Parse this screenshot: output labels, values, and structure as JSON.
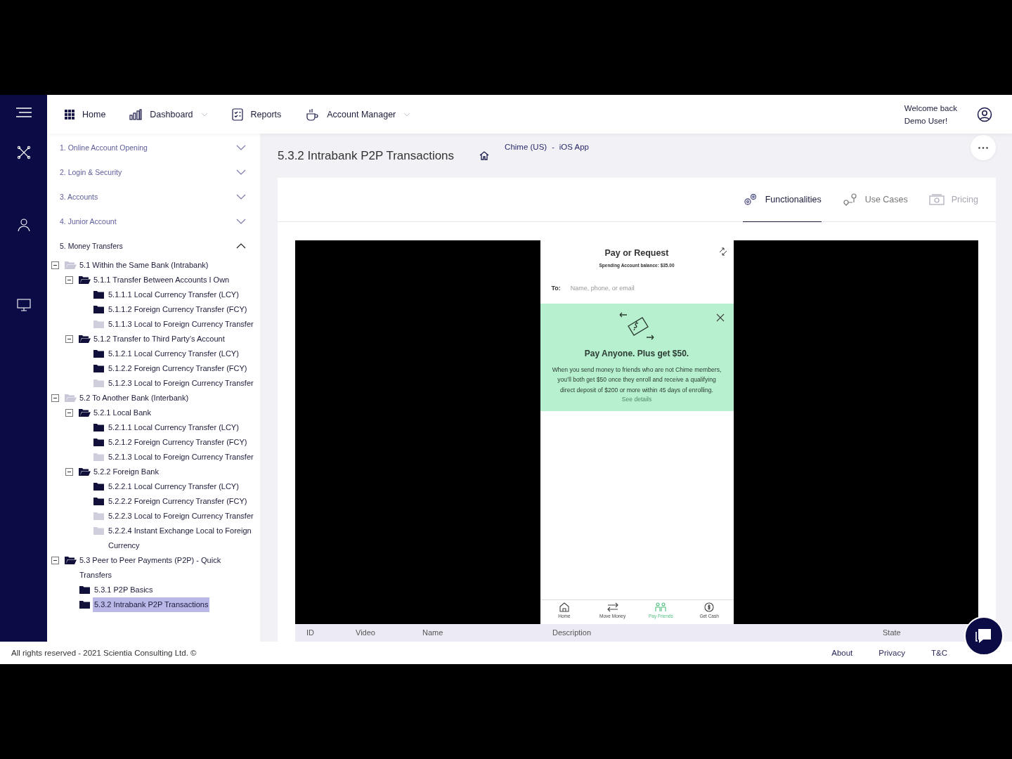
{
  "nav": {
    "items": [
      {
        "label": "Home",
        "dropdown": false
      },
      {
        "label": "Dashboard",
        "dropdown": true
      },
      {
        "label": "Reports",
        "dropdown": false
      },
      {
        "label": "Account Manager",
        "dropdown": true
      }
    ],
    "welcome": [
      "Welcome back",
      "Demo User!"
    ]
  },
  "sections": [
    {
      "label": "1. Online Account Opening",
      "expanded": false
    },
    {
      "label": "2. Login & Security",
      "expanded": false
    },
    {
      "label": "3. Accounts",
      "expanded": false
    },
    {
      "label": "4. Junior Account",
      "expanded": false
    },
    {
      "label": "5. Money Transfers",
      "expanded": true,
      "tree": [
        {
          "label": "5.1 Within the Same Bank (Intrabank)",
          "expanded": true,
          "disabled": true,
          "children": [
            {
              "label": "5.1.1 Transfer Between Accounts I Own",
              "expanded": true,
              "disabled": false,
              "children": [
                {
                  "label": "5.1.1.1 Local Currency Transfer (LCY)",
                  "disabled": false,
                  "selected": false
                },
                {
                  "label": "5.1.1.2 Foreign Currency Transfer (FCY)",
                  "disabled": false,
                  "selected": false
                },
                {
                  "label": "5.1.1.3 Local to Foreign Currency Transfer",
                  "disabled": true,
                  "selected": false
                }
              ]
            },
            {
              "label": "5.1.2 Transfer to Third Party’s Account",
              "expanded": true,
              "disabled": false,
              "children": [
                {
                  "label": "5.1.2.1 Local Currency Transfer (LCY)",
                  "disabled": false,
                  "selected": false
                },
                {
                  "label": "5.1.2.2 Foreign Currency Transfer (FCY)",
                  "disabled": false,
                  "selected": false
                },
                {
                  "label": "5.1.2.3 Local to Foreign Currency Transfer",
                  "disabled": true,
                  "selected": false
                }
              ]
            }
          ]
        },
        {
          "label": "5.2 To Another Bank (Interbank)",
          "expanded": true,
          "disabled": true,
          "children": [
            {
              "label": "5.2.1 Local Bank",
              "expanded": true,
              "disabled": false,
              "children": [
                {
                  "label": "5.2.1.1 Local Currency Transfer (LCY)",
                  "disabled": false,
                  "selected": false
                },
                {
                  "label": "5.2.1.2 Foreign Currency Transfer (FCY)",
                  "disabled": false,
                  "selected": false
                },
                {
                  "label": "5.2.1.3 Local to Foreign Currency Transfer",
                  "disabled": true,
                  "selected": false
                }
              ]
            },
            {
              "label": "5.2.2 Foreign Bank",
              "expanded": true,
              "disabled": false,
              "children": [
                {
                  "label": "5.2.2.1 Local Currency Transfer (LCY)",
                  "disabled": false,
                  "selected": false
                },
                {
                  "label": "5.2.2.2 Foreign Currency Transfer (FCY)",
                  "disabled": false,
                  "selected": false
                },
                {
                  "label": "5.2.2.3 Local to Foreign Currency Transfer",
                  "disabled": true,
                  "selected": false
                },
                {
                  "label": "5.2.2.4 Instant Exchange Local to Foreign Currency",
                  "disabled": true,
                  "selected": false
                }
              ]
            }
          ]
        },
        {
          "label": "5.3 Peer to Peer Payments (P2P) - Quick Transfers",
          "expanded": true,
          "disabled": false,
          "children": [
            {
              "label": "5.3.1 P2P Basics",
              "disabled": false,
              "selected": false
            },
            {
              "label": "5.3.2 Intrabank P2P Transactions",
              "disabled": false,
              "selected": true
            }
          ]
        }
      ]
    }
  ],
  "page": {
    "title": "5.3.2 Intrabank P2P Transactions",
    "breadcrumb": [
      "Chime (US)",
      "iOS App"
    ],
    "separator": "-"
  },
  "tabs": [
    {
      "label": "Functionalities",
      "selected": true,
      "disabled": false
    },
    {
      "label": "Use Cases",
      "selected": false,
      "disabled": false
    },
    {
      "label": "Pricing",
      "selected": false,
      "disabled": true
    }
  ],
  "phone": {
    "title": "Pay or Request",
    "balance": "Spending Account balance: $35.00",
    "to_label": "To:",
    "placeholder": "Name, phone, or email",
    "promo": {
      "headline": "Pay Anyone. Plus get $50.",
      "body": "When you send money to friends who are not Chime members, you’ll both get $50 once they enroll and receive a qualifying direct deposit of $200 or more within 45 days of enrolling.",
      "link": "See details"
    },
    "tabbar": [
      {
        "label": "Home",
        "selected": false
      },
      {
        "label": "Move Money",
        "selected": false
      },
      {
        "label": "Pay Friends",
        "selected": true
      },
      {
        "label": "Get Cash",
        "selected": false
      }
    ]
  },
  "table": {
    "columns": [
      "ID",
      "Video",
      "Name",
      "Description",
      "State"
    ]
  },
  "footer": {
    "copyright": "All rights reserved - 2021 Scientia Consulting Ltd. ©",
    "links": [
      "About",
      "Privacy",
      "T&C"
    ]
  }
}
